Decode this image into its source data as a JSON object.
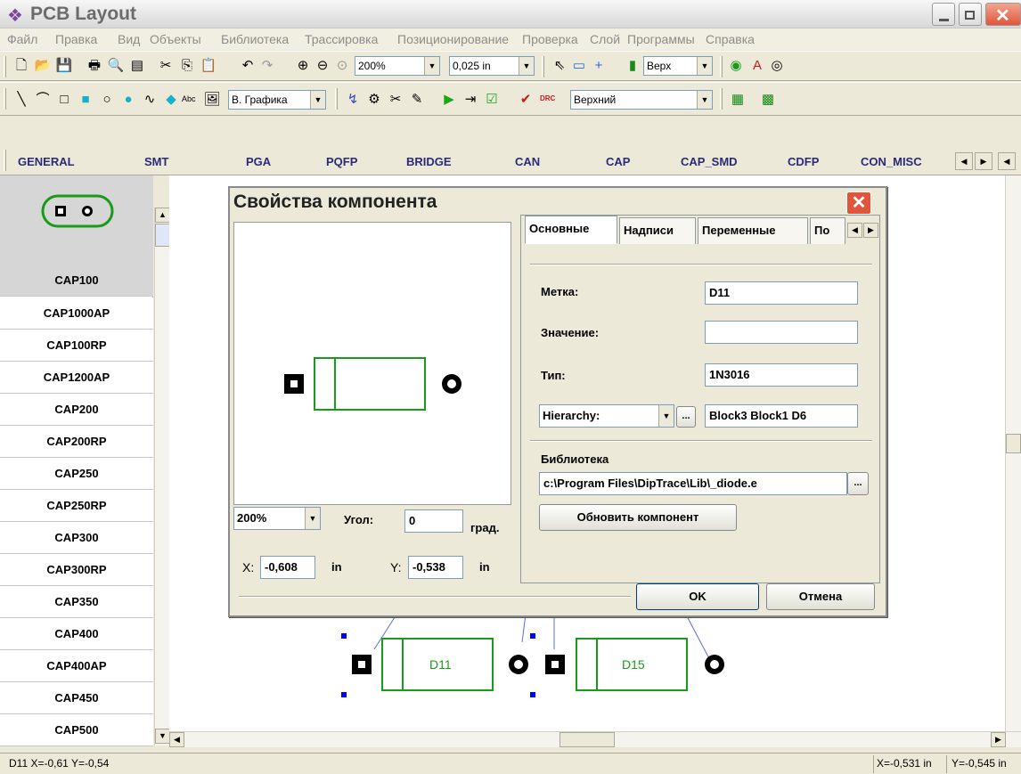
{
  "window": {
    "title": "PCB Layout"
  },
  "menu": [
    "Файл",
    "Правка",
    "Вид",
    "Объекты",
    "Библиотека",
    "Трассировка",
    "Позиционирование",
    "Проверка",
    "Слой",
    "Программы",
    "Справка"
  ],
  "toolbar1": {
    "zoom": "200%",
    "grid": "0,025 in",
    "side": "Верх"
  },
  "toolbar2": {
    "text_icon": "Abc",
    "layer_group": "В. Графика",
    "layer": "Верхний",
    "drc_label": "DRC"
  },
  "library_tabs": [
    "GENERAL",
    "SMT",
    "PGA",
    "PQFP",
    "BRIDGE",
    "CAN",
    "CAP",
    "CAP_SMD",
    "CDFP",
    "CON_MISC"
  ],
  "components": [
    "CAP100",
    "CAP1000AP",
    "CAP100RP",
    "CAP1200AP",
    "CAP200",
    "CAP200RP",
    "CAP250",
    "CAP250RP",
    "CAP300",
    "CAP300RP",
    "CAP350",
    "CAP400",
    "CAP400AP",
    "CAP450",
    "CAP500"
  ],
  "canvas": {
    "parts": [
      "D11",
      "D15"
    ]
  },
  "dialog": {
    "title": "Свойства компонента",
    "tabs": [
      "Основные",
      "Надписи",
      "Переменные",
      "По"
    ],
    "label_field": {
      "label": "Метка:",
      "value": "D11"
    },
    "value_field": {
      "label": "Значение:",
      "value": ""
    },
    "type_field": {
      "label": "Тип:",
      "value": "1N3016"
    },
    "hierarchy": {
      "selected": "Hierarchy:",
      "browse": "...",
      "value": "Block3 Block1 D6"
    },
    "library": {
      "label": "Библиотека",
      "path": "c:\\Program Files\\DipTrace\\Lib\\_diode.e",
      "browse": "..."
    },
    "update_button": "Обновить компонент",
    "zoom": "200%",
    "angle": {
      "label": "Угол:",
      "value": "0",
      "unit": "град."
    },
    "x": {
      "label": "X:",
      "value": "-0,608",
      "unit": "in"
    },
    "y": {
      "label": "Y:",
      "value": "-0,538",
      "unit": "in"
    },
    "ok": "OK",
    "cancel": "Отмена"
  },
  "status": {
    "left": "D11  X=-0,61  Y=-0,54",
    "x": "X=-0,531 in",
    "y": "Y=-0,545 in"
  },
  "colors": {
    "component_outline": "#1a9a1a",
    "ratsnest": "#5b6fd6",
    "selection": "#0000ff",
    "close_button": "#e0553c"
  }
}
